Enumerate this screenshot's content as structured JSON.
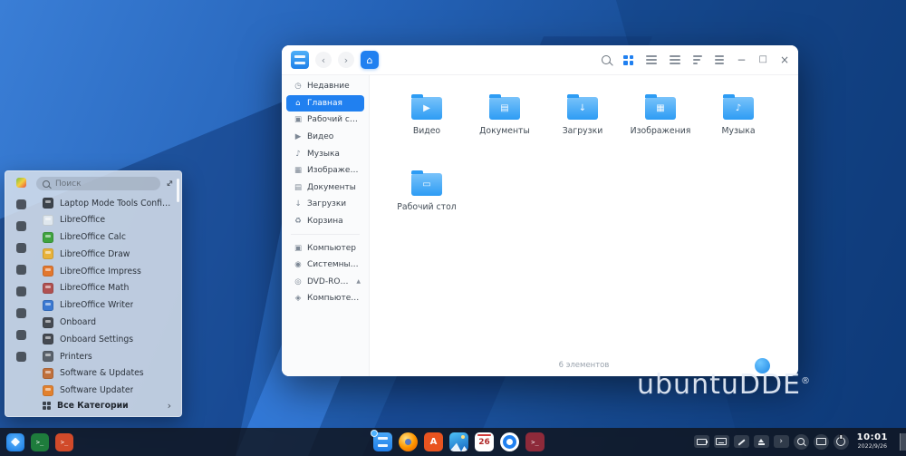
{
  "desktop": {
    "watermark": "ubuntuDDE",
    "watermark_reg": "®"
  },
  "launcher": {
    "search_placeholder": "Поиск",
    "expand_glyph": "↔",
    "apps": [
      {
        "label": "Laptop Mode Tools Configurati...",
        "color": "#3d444c"
      },
      {
        "label": "LibreOffice",
        "color": "#dfe7ee"
      },
      {
        "label": "LibreOffice Calc",
        "color": "#3fa33f"
      },
      {
        "label": "LibreOffice Draw",
        "color": "#e8b23a"
      },
      {
        "label": "LibreOffice Impress",
        "color": "#e2772e"
      },
      {
        "label": "LibreOffice Math",
        "color": "#b05050"
      },
      {
        "label": "LibreOffice Writer",
        "color": "#3a78d2"
      },
      {
        "label": "Onboard",
        "color": "#454a52"
      },
      {
        "label": "Onboard Settings",
        "color": "#454a52"
      },
      {
        "label": "Printers",
        "color": "#5a626c"
      },
      {
        "label": "Software & Updates",
        "color": "#c0703c"
      },
      {
        "label": "Software Updater",
        "color": "#e2812e"
      }
    ],
    "footer_label": "Все Категории",
    "footer_chevron": "›"
  },
  "window": {
    "nav_back": "‹",
    "nav_forward": "›",
    "home_glyph": "⌂",
    "controls": {
      "minimize": "−",
      "maximize": "□",
      "close": "×"
    },
    "sidebar": [
      {
        "label": "Недавние",
        "glyph": "◷"
      },
      {
        "label": "Главная",
        "glyph": "⌂"
      },
      {
        "label": "Рабочий стол",
        "glyph": "▣"
      },
      {
        "label": "Видео",
        "glyph": "▶"
      },
      {
        "label": "Музыка",
        "glyph": "♪"
      },
      {
        "label": "Изображения",
        "glyph": "▦"
      },
      {
        "label": "Документы",
        "glyph": "▤"
      },
      {
        "label": "Загрузки",
        "glyph": "↓"
      },
      {
        "label": "Корзина",
        "glyph": "♻"
      }
    ],
    "devices": [
      {
        "label": "Компьютер",
        "glyph": "▣"
      },
      {
        "label": "Системный Диск",
        "glyph": "◉"
      },
      {
        "label": "DVD-ROM При...",
        "glyph": "◎",
        "eject": "▲"
      },
      {
        "label": "Компьютеры в сети",
        "glyph": "◈"
      }
    ],
    "folders": [
      {
        "label": "Видео",
        "glyph": "▶"
      },
      {
        "label": "Документы",
        "glyph": "▤"
      },
      {
        "label": "Загрузки",
        "glyph": "↓"
      },
      {
        "label": "Изображения",
        "glyph": "▦"
      },
      {
        "label": "Музыка",
        "glyph": "♪"
      },
      {
        "label": "Рабочий стол",
        "glyph": "▭"
      }
    ],
    "status": "6 элементов"
  },
  "dock": {
    "prompt": ">_",
    "software_letter": "A",
    "calendar_day": "26",
    "tray_chevron": "›",
    "time": "10:01",
    "date": "2022/9/26"
  }
}
